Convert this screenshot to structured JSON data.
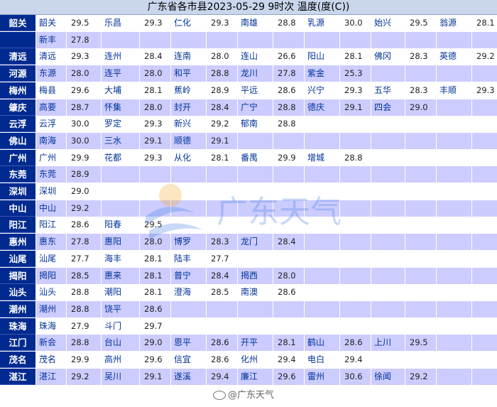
{
  "title": "广东省各市县2023-05-29  9时次  温度(度(C))",
  "watermark_text": "广东天气",
  "footer": {
    "weibo_handle": "@广东天气"
  },
  "colors": {
    "header_bg": "#c9d6ec",
    "city_bg": "#002a8f",
    "alt_row": "#ccccff",
    "station_text": "#003399"
  },
  "rows": [
    {
      "city": "韶关",
      "cells": [
        "韶关",
        "29.5",
        "乐昌",
        "29.3",
        "仁化",
        "29.3",
        "南雄",
        "28.8",
        "乳源",
        "30.0",
        "始兴",
        "29.5",
        "翁源",
        "28.1"
      ]
    },
    {
      "city": "",
      "cells": [
        "新丰",
        "27.8",
        "",
        "",
        "",
        "",
        "",
        "",
        "",
        "",
        "",
        "",
        "",
        ""
      ]
    },
    {
      "city": "清远",
      "cells": [
        "清远",
        "29.3",
        "连州",
        "28.4",
        "连南",
        "28.0",
        "连山",
        "26.6",
        "阳山",
        "28.1",
        "佛冈",
        "28.3",
        "英德",
        "29.2"
      ]
    },
    {
      "city": "河源",
      "cells": [
        "东源",
        "28.0",
        "连平",
        "28.0",
        "和平",
        "28.8",
        "龙川",
        "27.8",
        "紫金",
        "25.3",
        "",
        "",
        "",
        ""
      ]
    },
    {
      "city": "梅州",
      "cells": [
        "梅县",
        "29.6",
        "大埔",
        "28.1",
        "蕉岭",
        "28.9",
        "平远",
        "28.6",
        "兴宁",
        "29.3",
        "五华",
        "28.3",
        "丰顺",
        "29.3"
      ]
    },
    {
      "city": "肇庆",
      "cells": [
        "高要",
        "28.7",
        "怀集",
        "28.0",
        "封开",
        "28.4",
        "广宁",
        "28.8",
        "德庆",
        "29.1",
        "四会",
        "29.0",
        "",
        ""
      ]
    },
    {
      "city": "云浮",
      "cells": [
        "云浮",
        "30.0",
        "罗定",
        "29.3",
        "新兴",
        "29.2",
        "郁南",
        "28.8",
        "",
        "",
        "",
        "",
        "",
        ""
      ]
    },
    {
      "city": "佛山",
      "cells": [
        "南海",
        "30.0",
        "三水",
        "29.1",
        "顺德",
        "29.1",
        "",
        "",
        "",
        "",
        "",
        "",
        "",
        ""
      ]
    },
    {
      "city": "广州",
      "cells": [
        "广州",
        "29.9",
        "花都",
        "29.3",
        "从化",
        "28.1",
        "番禺",
        "29.9",
        "增城",
        "28.8",
        "",
        "",
        "",
        ""
      ]
    },
    {
      "city": "东莞",
      "cells": [
        "东莞",
        "28.9",
        "",
        "",
        "",
        "",
        "",
        "",
        "",
        "",
        "",
        "",
        "",
        ""
      ]
    },
    {
      "city": "深圳",
      "cells": [
        "深圳",
        "29.0",
        "",
        "",
        "",
        "",
        "",
        "",
        "",
        "",
        "",
        "",
        "",
        ""
      ]
    },
    {
      "city": "中山",
      "cells": [
        "中山",
        "29.2",
        "",
        "",
        "",
        "",
        "",
        "",
        "",
        "",
        "",
        "",
        "",
        ""
      ]
    },
    {
      "city": "阳江",
      "cells": [
        "阳江",
        "28.6",
        "阳春",
        "29.5",
        "",
        "",
        "",
        "",
        "",
        "",
        "",
        "",
        "",
        ""
      ]
    },
    {
      "city": "惠州",
      "cells": [
        "惠东",
        "27.8",
        "惠阳",
        "28.0",
        "博罗",
        "28.3",
        "龙门",
        "28.4",
        "",
        "",
        "",
        "",
        "",
        ""
      ]
    },
    {
      "city": "汕尾",
      "cells": [
        "汕尾",
        "27.7",
        "海丰",
        "28.1",
        "陆丰",
        "27.7",
        "",
        "",
        "",
        "",
        "",
        "",
        "",
        ""
      ]
    },
    {
      "city": "揭阳",
      "cells": [
        "揭阳",
        "28.5",
        "惠来",
        "28.1",
        "普宁",
        "28.4",
        "揭西",
        "28.0",
        "",
        "",
        "",
        "",
        "",
        ""
      ]
    },
    {
      "city": "汕头",
      "cells": [
        "汕头",
        "28.8",
        "潮阳",
        "28.1",
        "澄海",
        "28.5",
        "南澳",
        "28.6",
        "",
        "",
        "",
        "",
        "",
        ""
      ]
    },
    {
      "city": "潮州",
      "cells": [
        "潮州",
        "28.8",
        "饶平",
        "28.6",
        "",
        "",
        "",
        "",
        "",
        "",
        "",
        "",
        "",
        ""
      ]
    },
    {
      "city": "珠海",
      "cells": [
        "珠海",
        "27.9",
        "斗门",
        "29.7",
        "",
        "",
        "",
        "",
        "",
        "",
        "",
        "",
        "",
        ""
      ]
    },
    {
      "city": "江门",
      "cells": [
        "新会",
        "28.8",
        "台山",
        "29.0",
        "恩平",
        "28.6",
        "开平",
        "28.1",
        "鹤山",
        "28.6",
        "上川",
        "29.5",
        "",
        ""
      ]
    },
    {
      "city": "茂名",
      "cells": [
        "茂名",
        "29.9",
        "高州",
        "29.6",
        "信宜",
        "28.6",
        "化州",
        "29.4",
        "电白",
        "29.4",
        "",
        "",
        "",
        ""
      ]
    },
    {
      "city": "湛江",
      "cells": [
        "湛江",
        "29.2",
        "吴川",
        "29.1",
        "遂溪",
        "29.4",
        "廉江",
        "29.6",
        "雷州",
        "30.6",
        "徐闻",
        "29.2",
        "",
        ""
      ]
    }
  ]
}
